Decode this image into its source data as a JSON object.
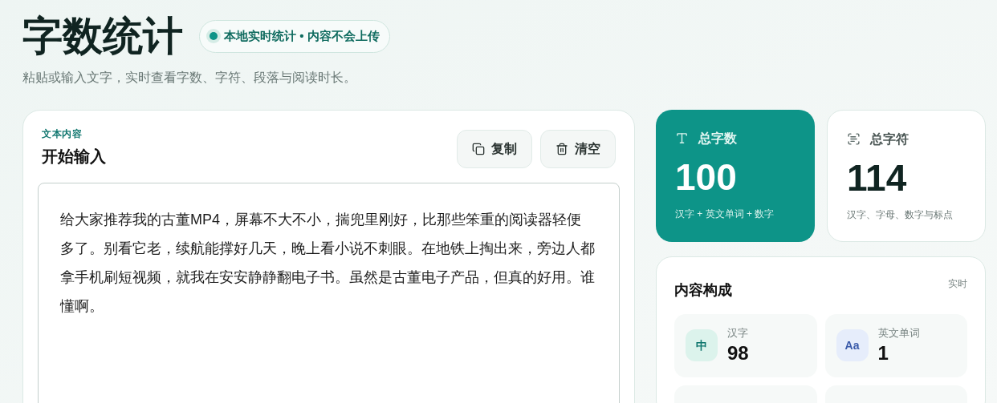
{
  "header": {
    "title": "字数统计",
    "badge": {
      "label": "本地实时统计 • 内容不会上传",
      "live": true
    },
    "subtitle": "粘贴或输入文字，实时查看字数、字符、段落与阅读时长。"
  },
  "editor": {
    "eyebrow": "文本内容",
    "title": "开始输入",
    "buttons": [
      {
        "kind": "copy",
        "label": "复制"
      },
      {
        "kind": "clear",
        "label": "清空"
      }
    ],
    "value": "给大家推荐我的古董MP4，屏幕不大不小，揣兜里刚好，比那些笨重的阅读器轻便多了。别看它老，续航能撑好几天，晚上看小说不刺眼。在地铁上掏出来，旁边人都拿手机刷短视频，就我在安安静静翻电子书。虽然是古董电子产品，但真的好用。谁懂啊。"
  },
  "stats": [
    {
      "kind": "words",
      "label": "总字数",
      "value": "100",
      "note": "汉字 + 英文单词 + 数字",
      "selected": true
    },
    {
      "kind": "chars",
      "label": "总字符",
      "value": "114",
      "note": "汉字、字母、数字与标点",
      "selected": false
    }
  ],
  "composition": {
    "title": "内容构成",
    "tag": "实时",
    "items": [
      {
        "badge": "中",
        "label": "汉字",
        "value": "98",
        "color": "#0f766e"
      },
      {
        "badge": "Aa",
        "label": "英文单词",
        "value": "1",
        "color": "#3b5ba9"
      }
    ]
  }
}
